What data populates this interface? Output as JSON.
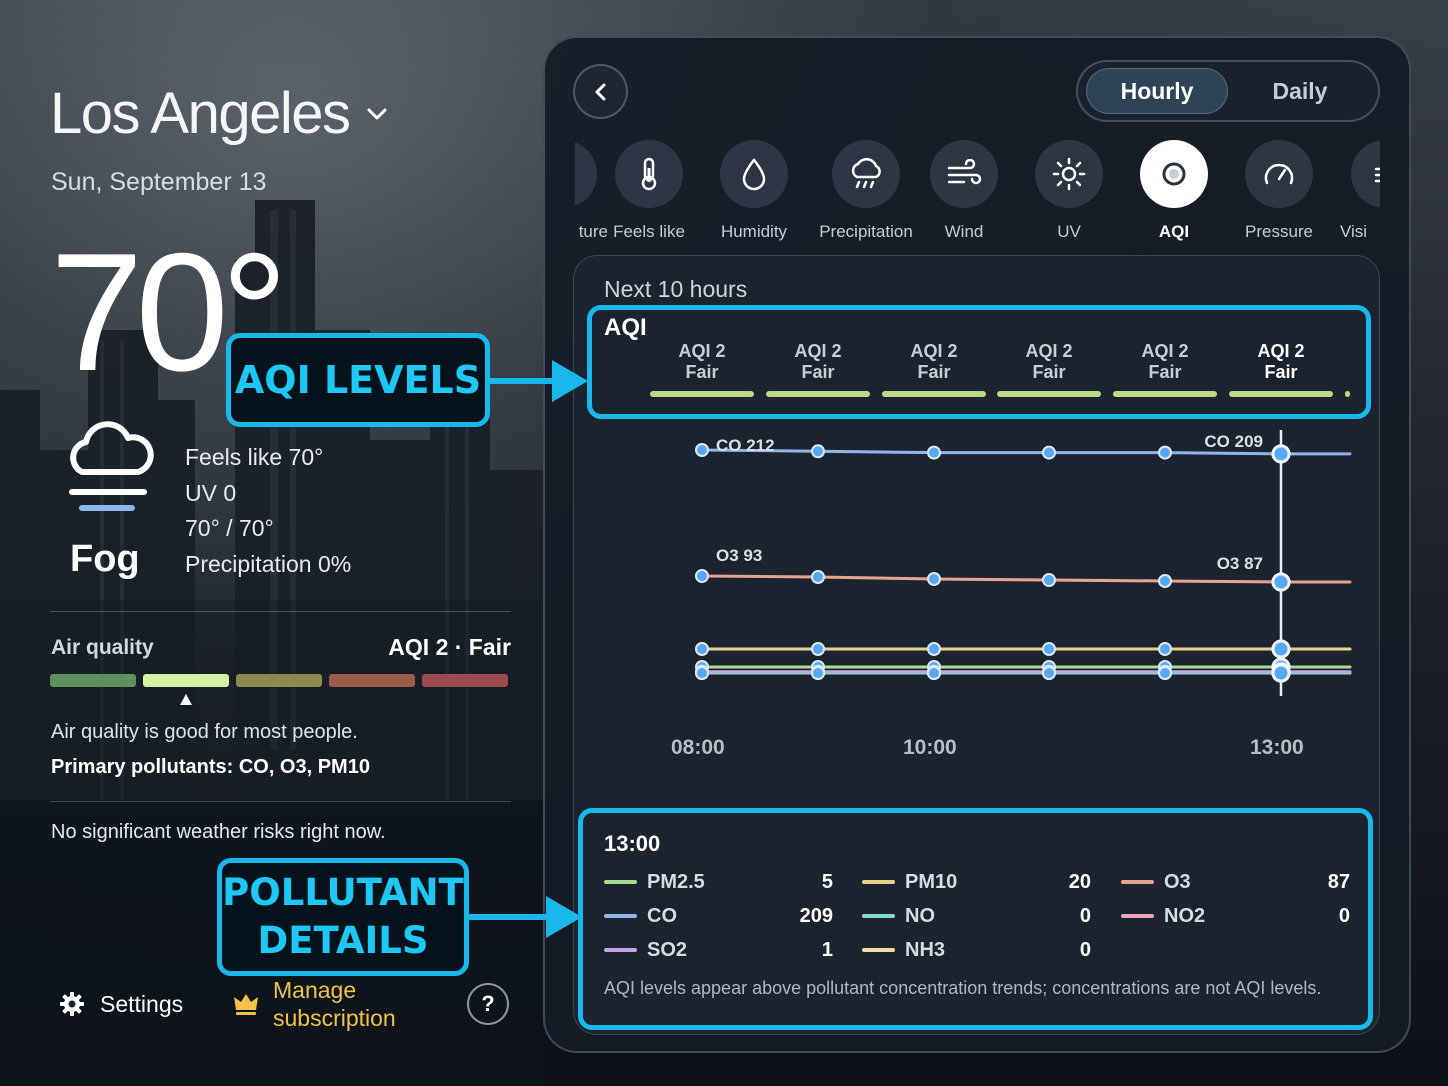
{
  "location": {
    "city": "Los Angeles",
    "date": "Sun, September 13"
  },
  "current": {
    "temperature": "70°",
    "condition": "Fog",
    "feels_like": "Feels like 70°",
    "uv": "UV 0",
    "high_low": "70° / 70°",
    "precipitation": "Precipitation 0%"
  },
  "air_quality": {
    "label": "Air quality",
    "value": "AQI 2 · Fair",
    "level_index": 1,
    "scale_colors": [
      "#5f8f5c",
      "#d6f0a6",
      "#8c8a4e",
      "#9a5c48",
      "#9c4a4c"
    ],
    "description": "Air quality is good for most people.",
    "pollutants": "Primary pollutants: CO, O3, PM10",
    "risk": "No significant weather risks right now."
  },
  "footer": {
    "settings": "Settings",
    "manage_line1": "Manage",
    "manage_line2": "subscription",
    "help": "?"
  },
  "toggle": {
    "hourly": "Hourly",
    "daily": "Daily",
    "selected": "Hourly"
  },
  "metrics": [
    {
      "label": "ture",
      "icon": "temperature-icon"
    },
    {
      "label": "Feels like",
      "icon": "thermometer-icon"
    },
    {
      "label": "Humidity",
      "icon": "droplet-icon"
    },
    {
      "label": "Precipitation",
      "icon": "rain-cloud-icon"
    },
    {
      "label": "Wind",
      "icon": "wind-icon"
    },
    {
      "label": "UV",
      "icon": "sun-icon"
    },
    {
      "label": "AQI",
      "icon": "aqi-icon",
      "active": true
    },
    {
      "label": "Pressure",
      "icon": "gauge-icon"
    },
    {
      "label": "Visi",
      "icon": "visibility-icon"
    }
  ],
  "chart_header": {
    "subtitle": "Next 10 hours",
    "title": "AQI"
  },
  "aqi_columns": [
    {
      "top": "AQI 2",
      "bottom": "Fair"
    },
    {
      "top": "AQI 2",
      "bottom": "Fair"
    },
    {
      "top": "AQI 2",
      "bottom": "Fair"
    },
    {
      "top": "AQI 2",
      "bottom": "Fair"
    },
    {
      "top": "AQI 2",
      "bottom": "Fair"
    },
    {
      "top": "AQI 2",
      "bottom": "Fair",
      "selected": true
    }
  ],
  "chart_data": {
    "type": "line",
    "x": [
      "08:00",
      "09:00",
      "10:00",
      "11:00",
      "12:00",
      "13:00"
    ],
    "x_ticks": [
      "08:00",
      "10:00",
      "13:00"
    ],
    "selected_x": "13:00",
    "series": [
      {
        "name": "CO",
        "color": "#8fb6e8",
        "values": [
          212,
          211,
          210,
          210,
          210,
          209
        ]
      },
      {
        "name": "O3",
        "color": "#e8a48f",
        "values": [
          93,
          92,
          90,
          89,
          88,
          87
        ]
      },
      {
        "name": "PM10",
        "color": "#ead48a",
        "values": [
          20,
          20,
          20,
          20,
          20,
          20
        ]
      },
      {
        "name": "PM2.5",
        "color": "#a9dc8e",
        "values": [
          5,
          5,
          5,
          5,
          5,
          5
        ]
      },
      {
        "name": "SO2",
        "color": "#c3a5ea",
        "values": [
          1,
          1,
          1,
          1,
          1,
          1
        ]
      },
      {
        "name": "NO",
        "color": "#84dccb",
        "values": [
          0,
          0,
          0,
          0,
          0,
          0
        ]
      },
      {
        "name": "NH3",
        "color": "#f0dd9e",
        "values": [
          0,
          0,
          0,
          0,
          0,
          0
        ]
      },
      {
        "name": "NO2",
        "color": "#eba4c4",
        "values": [
          0,
          0,
          0,
          0,
          0,
          0
        ]
      }
    ],
    "point_labels": {
      "co_start": "CO 212",
      "co_end": "CO 209",
      "o3_start": "O3 93",
      "o3_end": "O3 87"
    }
  },
  "details": {
    "time": "13:00",
    "pollutants": [
      {
        "name": "PM2.5",
        "value": "5",
        "color": "#a9dc8e"
      },
      {
        "name": "PM10",
        "value": "20",
        "color": "#ead48a"
      },
      {
        "name": "O3",
        "value": "87",
        "color": "#e8a48f"
      },
      {
        "name": "CO",
        "value": "209",
        "color": "#8fb6e8"
      },
      {
        "name": "NO",
        "value": "0",
        "color": "#84dccb"
      },
      {
        "name": "NO2",
        "value": "0",
        "color": "#eba4c4"
      },
      {
        "name": "SO2",
        "value": "1",
        "color": "#c3a5ea"
      },
      {
        "name": "NH3",
        "value": "0",
        "color": "#f0dd9e"
      }
    ],
    "note": "AQI levels appear above pollutant concentration trends; concentrations are not AQI levels."
  },
  "annotations": {
    "aqi_levels": "AQI LEVELS",
    "pollutant_line1": "POLLUTANT",
    "pollutant_line2": "DETAILS",
    "accent": "#19b8ea"
  }
}
